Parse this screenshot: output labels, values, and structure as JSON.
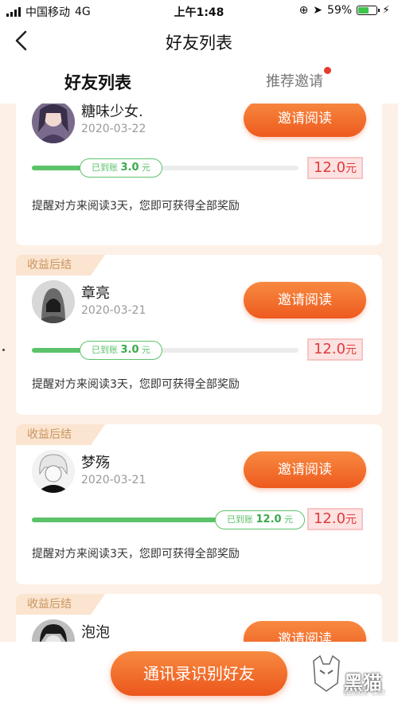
{
  "status_bar": {
    "carrier": "中国移动",
    "network": "4G",
    "time": "上午1:48",
    "battery": "59%",
    "battery_level": 0.59
  },
  "nav": {
    "title": "好友列表"
  },
  "tabs": [
    {
      "label": "好友列表",
      "active": true
    },
    {
      "label": "推荐邀请",
      "active": false,
      "has_badge": true
    }
  ],
  "friends": [
    {
      "tag": "",
      "name": "糖味少女.",
      "date": "2020-03-22",
      "invite_label": "邀请阅读",
      "progress_prefix": "已到账",
      "received": "3.0",
      "received_unit": "元",
      "progress": 0.19,
      "reward": "12.0",
      "reward_unit": "元",
      "hint": "提醒对方来阅读3天，您即可获得全部奖励"
    },
    {
      "tag": "收益后结",
      "name": "章亮",
      "date": "2020-03-21",
      "invite_label": "邀请阅读",
      "progress_prefix": "已到账",
      "received": "3.0",
      "received_unit": "元",
      "progress": 0.19,
      "reward": "12.0",
      "reward_unit": "元",
      "hint": "提醒对方来阅读3天，您即可获得全部奖励"
    },
    {
      "tag": "收益后结",
      "name": "梦殇",
      "date": "2020-03-21",
      "invite_label": "邀请阅读",
      "progress_prefix": "已到账",
      "received": "12.0",
      "received_unit": "元",
      "progress": 1.0,
      "reward": "12.0",
      "reward_unit": "元",
      "hint": "提醒对方来阅读3天，您即可获得全部奖励"
    },
    {
      "tag": "收益后结",
      "name": "泡泡",
      "date": "",
      "invite_label": "邀请阅读"
    }
  ],
  "bottom": {
    "contacts_button": "通讯录识别好友"
  },
  "watermark": {
    "text": "黑猫",
    "sub": "BLACK CAT"
  },
  "colors": {
    "accent_orange": "#ef5f22",
    "progress_green": "#5cc26a",
    "reward_red": "#e23a3a",
    "page_bg": "#fdf0e6"
  }
}
